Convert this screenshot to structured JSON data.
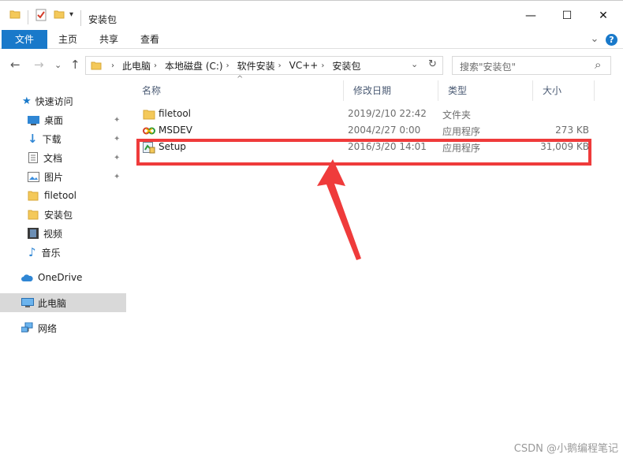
{
  "window": {
    "title": "安装包",
    "controls": {
      "minimize": "—",
      "maximize": "☐",
      "close": "✕"
    }
  },
  "ribbon": {
    "tabs": [
      {
        "label": "文件",
        "active": true
      },
      {
        "label": "主页"
      },
      {
        "label": "共享"
      },
      {
        "label": "查看"
      }
    ],
    "collapse_glyph": "⌄",
    "help_glyph": "?"
  },
  "nav": {
    "back": "←",
    "forward": "→",
    "recent": "⌄",
    "up": "↑",
    "breadcrumbs": [
      "此电脑",
      "本地磁盘 (C:)",
      "软件安装",
      "VC++",
      "安装包"
    ],
    "crumb_separator": "›",
    "dropdown": "⌄",
    "refresh": "↻",
    "search_placeholder": "搜索\"安装包\"",
    "search_glyph": "⌕"
  },
  "sidebar": {
    "items": [
      {
        "label": "快速访问",
        "icon": "star-icon"
      },
      {
        "label": "桌面",
        "icon": "desktop-icon",
        "pinned": true
      },
      {
        "label": "下载",
        "icon": "download-icon",
        "pinned": true
      },
      {
        "label": "文档",
        "icon": "document-icon",
        "pinned": true
      },
      {
        "label": "图片",
        "icon": "picture-icon",
        "pinned": true
      },
      {
        "label": "filetool",
        "icon": "folder-icon"
      },
      {
        "label": "安装包",
        "icon": "folder-icon"
      },
      {
        "label": "视频",
        "icon": "video-icon"
      },
      {
        "label": "音乐",
        "icon": "music-icon"
      },
      {
        "label": "OneDrive",
        "icon": "cloud-icon"
      },
      {
        "label": "此电脑",
        "icon": "computer-icon",
        "selected": true
      },
      {
        "label": "网络",
        "icon": "network-icon"
      }
    ],
    "pin_glyph": "📌"
  },
  "file_list": {
    "columns": {
      "name": "名称",
      "date": "修改日期",
      "type": "类型",
      "size": "大小"
    },
    "sort_glyph": "^",
    "rows": [
      {
        "name": "filetool",
        "date": "2019/2/10 22:42",
        "type": "文件夹",
        "size": "",
        "icon": "folder-icon"
      },
      {
        "name": "MSDEV",
        "date": "2004/2/27 0:00",
        "type": "应用程序",
        "size": "273 KB",
        "icon": "msdev-app-icon"
      },
      {
        "name": "Setup",
        "date": "2016/3/20 14:01",
        "type": "应用程序",
        "size": "31,009 KB",
        "icon": "setup-app-icon"
      }
    ]
  },
  "colors": {
    "accent": "#1979ca",
    "annotation": "#ef3b3b",
    "folder": "#f4c95a"
  },
  "watermark": "CSDN @小鹅编程笔记"
}
